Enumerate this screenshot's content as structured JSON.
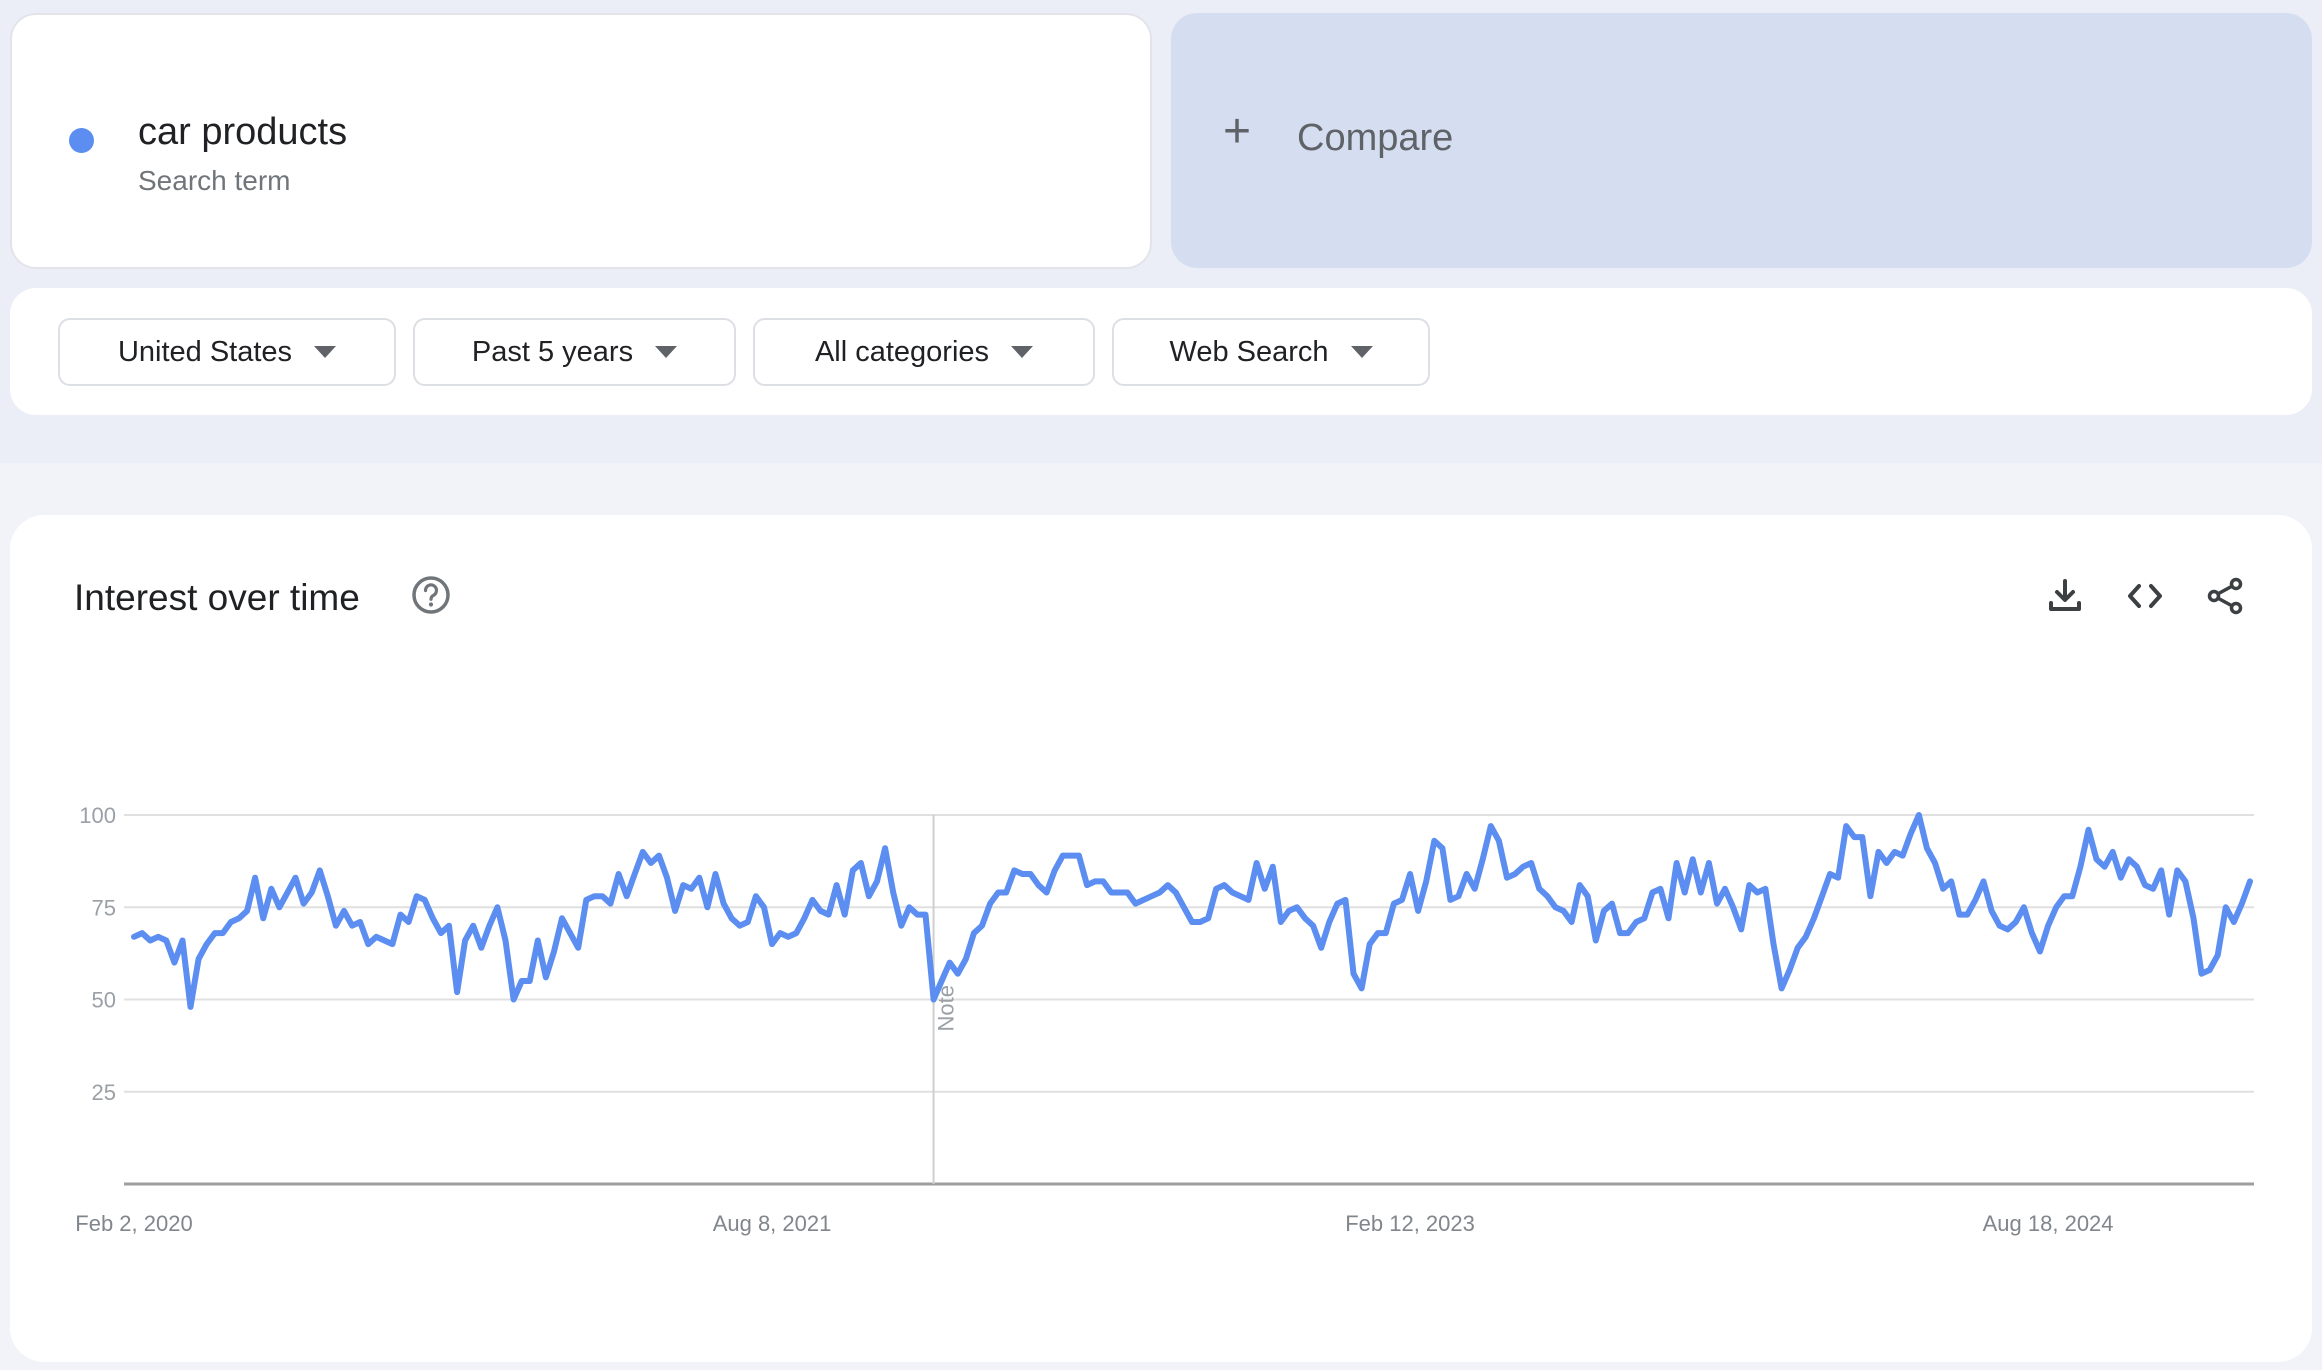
{
  "search": {
    "term": "car products",
    "term_type": "Search term",
    "term_color": "#5b8ef0",
    "compare_label": "Compare",
    "compare_icon": "plus-icon"
  },
  "filters": [
    {
      "label": "United States",
      "icon": "dropdown-arrow-icon"
    },
    {
      "label": "Past 5 years",
      "icon": "dropdown-arrow-icon"
    },
    {
      "label": "All categories",
      "icon": "dropdown-arrow-icon"
    },
    {
      "label": "Web Search",
      "icon": "dropdown-arrow-icon"
    }
  ],
  "chart_card": {
    "title": "Interest over time",
    "help_icon": "help-circle-icon",
    "tools": [
      {
        "name": "download-icon",
        "label": "Download CSV"
      },
      {
        "name": "embed-code-icon",
        "label": "Embed"
      },
      {
        "name": "share-icon",
        "label": "Share"
      }
    ]
  },
  "chart_data": {
    "type": "line",
    "title": "Interest over time",
    "xlabel": "",
    "ylabel": "",
    "ylim": [
      0,
      100
    ],
    "yticks": [
      "25",
      "50",
      "75",
      "100"
    ],
    "ytick_values": [
      25,
      50,
      75,
      100
    ],
    "x_start": "Feb 2, 2020",
    "x_ticks": [
      {
        "label": "Feb 2, 2020",
        "index": 0
      },
      {
        "label": "Aug 8, 2021",
        "index": 79
      },
      {
        "label": "Feb 12, 2023",
        "index": 158
      },
      {
        "label": "Aug 18, 2024",
        "index": 237
      }
    ],
    "annotation": {
      "label": "Note",
      "index": 99
    },
    "grid": true,
    "legend": "none",
    "series": [
      {
        "name": "car products",
        "color": "#5b8ef0",
        "values": [
          67,
          68,
          66,
          67,
          66,
          60,
          66,
          48,
          61,
          65,
          68,
          68,
          71,
          72,
          74,
          83,
          72,
          80,
          75,
          79,
          83,
          76,
          79,
          85,
          78,
          70,
          74,
          70,
          71,
          65,
          67,
          66,
          65,
          73,
          71,
          78,
          77,
          72,
          68,
          70,
          52,
          66,
          70,
          64,
          70,
          75,
          66,
          50,
          55,
          55,
          66,
          56,
          63,
          72,
          68,
          64,
          77,
          78,
          78,
          76,
          84,
          78,
          84,
          90,
          87,
          89,
          83,
          74,
          81,
          80,
          83,
          75,
          84,
          76,
          72,
          70,
          71,
          78,
          75,
          65,
          68,
          67,
          68,
          72,
          77,
          74,
          73,
          81,
          73,
          85,
          87,
          78,
          82,
          91,
          79,
          70,
          75,
          73,
          73,
          50,
          55,
          60,
          57,
          61,
          68,
          70,
          76,
          79,
          79,
          85,
          84,
          84,
          81,
          79,
          85,
          89,
          89,
          89,
          81,
          82,
          82,
          79,
          79,
          79,
          76,
          77,
          78,
          79,
          81,
          79,
          75,
          71,
          71,
          72,
          80,
          81,
          79,
          78,
          77,
          87,
          80,
          86,
          71,
          74,
          75,
          72,
          70,
          64,
          71,
          76,
          77,
          57,
          53,
          65,
          68,
          68,
          76,
          77,
          84,
          74,
          82,
          93,
          91,
          77,
          78,
          84,
          80,
          88,
          97,
          93,
          83,
          84,
          86,
          87,
          80,
          78,
          75,
          74,
          71,
          81,
          78,
          66,
          74,
          76,
          68,
          68,
          71,
          72,
          79,
          80,
          72,
          87,
          79,
          88,
          79,
          87,
          76,
          80,
          75,
          69,
          81,
          79,
          80,
          65,
          53,
          58,
          64,
          67,
          72,
          78,
          84,
          83,
          97,
          94,
          94,
          78,
          90,
          87,
          90,
          89,
          95,
          100,
          91,
          87,
          80,
          82,
          73,
          73,
          77,
          82,
          74,
          70,
          69,
          71,
          75,
          68,
          63,
          70,
          75,
          78,
          78,
          86,
          96,
          88,
          86,
          90,
          83,
          88,
          86,
          81,
          80,
          85,
          73,
          85,
          82,
          72,
          57,
          58,
          62,
          75,
          71,
          76,
          82
        ]
      }
    ]
  }
}
